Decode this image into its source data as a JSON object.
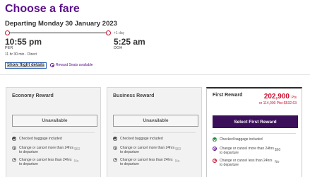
{
  "page": {
    "title": "Choose a fare",
    "date": "Departing Monday 30 January 2023"
  },
  "flight": {
    "departure_time": "10:55 pm",
    "departure_airport": "PER",
    "arrival_time": "5:25 am",
    "arrival_airport": "DOH",
    "day_offset": "+1 day",
    "duration": "11 hr 30 min · Direct",
    "show_details_label": "Show flight details",
    "reward_seats_label": "Reward Seats available"
  },
  "fares": [
    {
      "name": "Economy Reward",
      "button_label": "Unavailable",
      "features": {
        "baggage": "Checked baggage included",
        "change_more": "Change or cancel more than 24hrs to departure",
        "change_more_value": "$60",
        "change_less": "Change or cancel less than 24hrs to departure",
        "change_less_value": "No"
      }
    },
    {
      "name": "Business Reward",
      "button_label": "Unavailable",
      "features": {
        "baggage": "Checked baggage included",
        "change_more": "Change or cancel more than 24hrs to departure",
        "change_more_value": "$60",
        "change_less": "Change or cancel less than 24hrs to departure",
        "change_less_value": "No"
      }
    },
    {
      "name": "First Reward",
      "price": "202,900",
      "price_unit": "Pts",
      "price_alt": "or 114,000 Pts+$532.63",
      "button_label": "Select First Reward",
      "features": {
        "baggage": "Checked baggage included",
        "change_more": "Change or cancel more than 24hrs to departure",
        "change_more_value": "$60",
        "change_less": "Change or cancel less than 24hrs to departure",
        "change_less_value": "No"
      }
    }
  ],
  "colors": {
    "brand_purple": "#5c0f8b",
    "button_dark_purple": "#3b0f5a",
    "price_red": "#c8102e",
    "timeline_dot": "#c8102e",
    "included_green": "#1a8a3a"
  },
  "icons": [
    "departure-dot-icon",
    "arrival-dot-icon",
    "reward-seat-icon",
    "check-icon",
    "dollar-icon",
    "cross-icon"
  ]
}
